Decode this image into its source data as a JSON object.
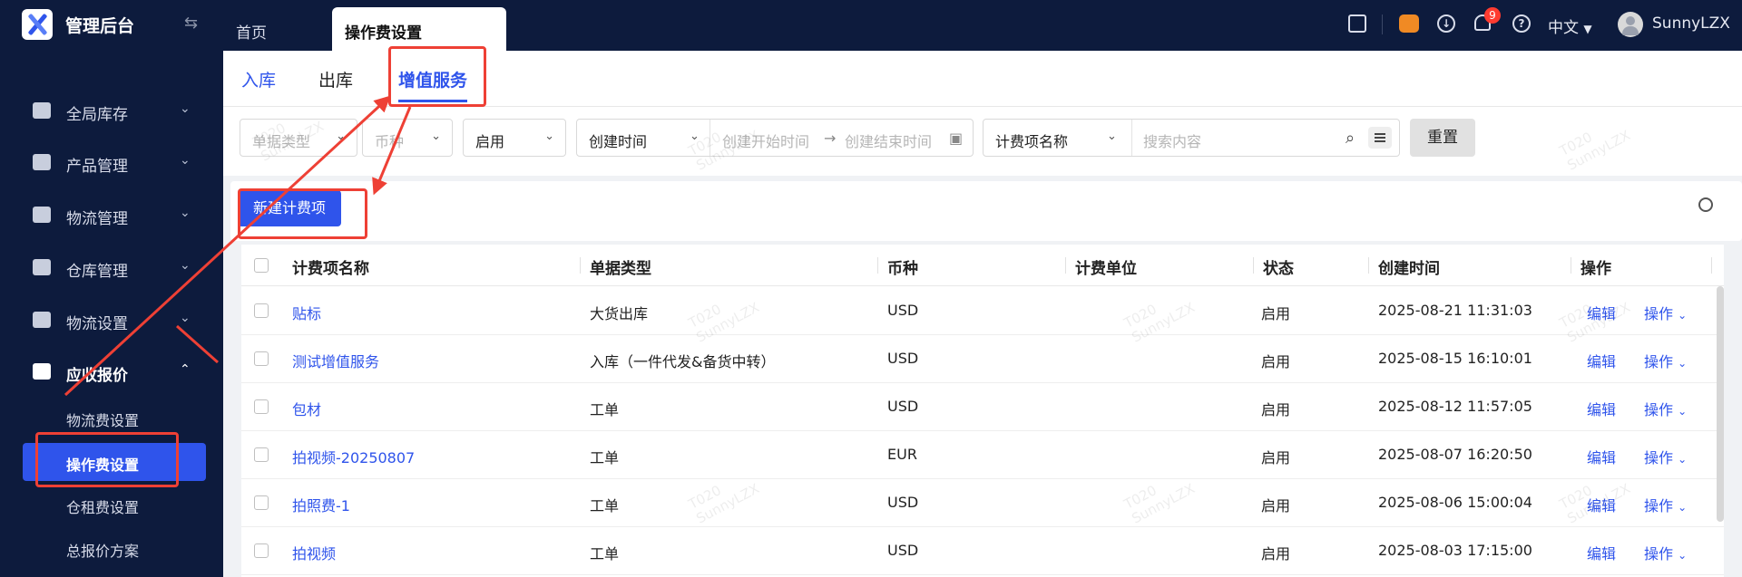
{
  "header": {
    "app_title": "管理后台",
    "tabs": [
      {
        "label": "首页"
      },
      {
        "label": "操作费设置"
      }
    ],
    "notification_count": "9",
    "language": "中文",
    "username": "SunnyLZX",
    "icons": [
      "logo-icon",
      "collapse-icon",
      "message-box-icon",
      "robot-icon",
      "download-icon",
      "bell-icon",
      "help-icon",
      "avatar-icon"
    ]
  },
  "sidebar": {
    "items": [
      {
        "label": "全局库存",
        "icon": "warehouse-icon"
      },
      {
        "label": "产品管理",
        "icon": "bag-icon"
      },
      {
        "label": "物流管理",
        "icon": "truck-icon"
      },
      {
        "label": "仓库管理",
        "icon": "house-icon"
      },
      {
        "label": "物流设置",
        "icon": "box-gear-icon"
      },
      {
        "label": "应收报价",
        "icon": "document-icon"
      }
    ],
    "sub_items": [
      {
        "label": "物流费设置"
      },
      {
        "label": "操作费设置"
      },
      {
        "label": "仓租费设置"
      },
      {
        "label": "总报价方案"
      }
    ]
  },
  "sub_tabs": [
    {
      "label": "入库"
    },
    {
      "label": "出库"
    },
    {
      "label": "增值服务"
    }
  ],
  "filters": {
    "doc_type_placeholder": "单据类型",
    "currency_placeholder": "币种",
    "status_value": "启用",
    "time_field": "创建时间",
    "start_placeholder": "创建开始时间",
    "range_arrow": "→",
    "end_placeholder": "创建结束时间",
    "search_field": "计费项名称",
    "search_placeholder": "搜索内容",
    "reset_label": "重置"
  },
  "actions": {
    "new_label": "新建计费项"
  },
  "table": {
    "columns": [
      "计费项名称",
      "单据类型",
      "币种",
      "计费单位",
      "状态",
      "创建时间",
      "操作"
    ],
    "edit_label": "编辑",
    "op_label": "操作",
    "rows": [
      {
        "name": "贴标",
        "doc_type": "大货出库",
        "currency": "USD",
        "unit": "",
        "status": "启用",
        "created": "2025-08-21 11:31:03"
      },
      {
        "name": "测试增值服务",
        "doc_type": "入库（一件代发&备货中转）",
        "currency": "USD",
        "unit": "",
        "status": "启用",
        "created": "2025-08-15 16:10:01"
      },
      {
        "name": "包材",
        "doc_type": "工单",
        "currency": "USD",
        "unit": "",
        "status": "启用",
        "created": "2025-08-12 11:57:05"
      },
      {
        "name": "拍视频-20250807",
        "doc_type": "工单",
        "currency": "EUR",
        "unit": "",
        "status": "启用",
        "created": "2025-08-07 16:20:50"
      },
      {
        "name": "拍照费-1",
        "doc_type": "工单",
        "currency": "USD",
        "unit": "",
        "status": "启用",
        "created": "2025-08-06 15:00:04"
      },
      {
        "name": "拍视频",
        "doc_type": "工单",
        "currency": "USD",
        "unit": "",
        "status": "启用",
        "created": "2025-08-03 17:15:00"
      }
    ]
  },
  "watermark": {
    "line1": "T020",
    "line2": "SunnyLZX"
  },
  "colors": {
    "accent": "#2f54eb",
    "nav_bg": "#0d1b3d",
    "annotation": "#ee4035"
  }
}
